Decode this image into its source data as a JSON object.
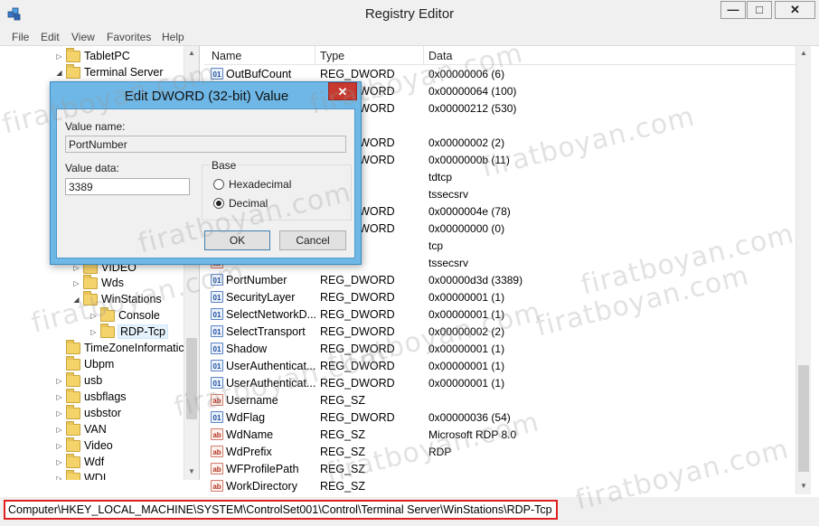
{
  "window": {
    "title": "Registry Editor",
    "minimize_glyph": "—",
    "maximize_glyph": "□",
    "close_glyph": "✕"
  },
  "menu": [
    "File",
    "Edit",
    "View",
    "Favorites",
    "Help"
  ],
  "tree": {
    "items": [
      {
        "label": "TabletPC",
        "arrow": "▷"
      },
      {
        "label": "Terminal Server",
        "arrow": "◢"
      },
      {
        "label": "VIDEO",
        "arrow": "▷"
      },
      {
        "label": "Wds",
        "arrow": "▷"
      },
      {
        "label": "WinStations",
        "arrow": "◢"
      },
      {
        "label": "Console",
        "arrow": "▷"
      },
      {
        "label": "RDP-Tcp",
        "arrow": "▷"
      },
      {
        "label": "TimeZoneInformatic",
        "arrow": ""
      },
      {
        "label": "Ubpm",
        "arrow": ""
      },
      {
        "label": "usb",
        "arrow": "▷"
      },
      {
        "label": "usbflags",
        "arrow": "▷"
      },
      {
        "label": "usbstor",
        "arrow": "▷"
      },
      {
        "label": "VAN",
        "arrow": "▷"
      },
      {
        "label": "Video",
        "arrow": "▷"
      },
      {
        "label": "Wdf",
        "arrow": "▷"
      },
      {
        "label": "WDI",
        "arrow": "▷"
      }
    ]
  },
  "list": {
    "columns": [
      "Name",
      "Type",
      "Data"
    ],
    "rows": [
      {
        "name": "OutBufCount",
        "type": "REG_DWORD",
        "data": "0x00000006 (6)",
        "kind": "bin"
      },
      {
        "name": "",
        "type": "REG_DWORD",
        "data": "0x00000064 (100)",
        "kind": "bin"
      },
      {
        "name": "",
        "type": "REG_DWORD",
        "data": "0x00000212 (530)",
        "kind": "bin"
      },
      {
        "name": "",
        "type": "",
        "data": "",
        "kind": "bin"
      },
      {
        "name": "",
        "type": "REG_DWORD",
        "data": "0x00000002 (2)",
        "kind": "bin"
      },
      {
        "name": "",
        "type": "REG_DWORD",
        "data": "0x0000000b (11)",
        "kind": "bin"
      },
      {
        "name": "",
        "type": "",
        "data": "tdtcp",
        "kind": "str"
      },
      {
        "name": "",
        "type": "",
        "data": "tssecsrv",
        "kind": "str"
      },
      {
        "name": "",
        "type": "REG_DWORD",
        "data": "0x0000004e (78)",
        "kind": "bin"
      },
      {
        "name": "",
        "type": "REG_DWORD",
        "data": "0x00000000 (0)",
        "kind": "bin"
      },
      {
        "name": "",
        "type": "",
        "data": "tcp",
        "kind": "str"
      },
      {
        "name": "",
        "type": "",
        "data": "tssecsrv",
        "kind": "str"
      },
      {
        "name": "PortNumber",
        "type": "REG_DWORD",
        "data": "0x00000d3d (3389)",
        "kind": "bin"
      },
      {
        "name": "SecurityLayer",
        "type": "REG_DWORD",
        "data": "0x00000001 (1)",
        "kind": "bin"
      },
      {
        "name": "SelectNetworkD...",
        "type": "REG_DWORD",
        "data": "0x00000001 (1)",
        "kind": "bin"
      },
      {
        "name": "SelectTransport",
        "type": "REG_DWORD",
        "data": "0x00000002 (2)",
        "kind": "bin"
      },
      {
        "name": "Shadow",
        "type": "REG_DWORD",
        "data": "0x00000001 (1)",
        "kind": "bin"
      },
      {
        "name": "UserAuthenticat...",
        "type": "REG_DWORD",
        "data": "0x00000001 (1)",
        "kind": "bin"
      },
      {
        "name": "UserAuthenticat...",
        "type": "REG_DWORD",
        "data": "0x00000001 (1)",
        "kind": "bin"
      },
      {
        "name": "Username",
        "type": "REG_SZ",
        "data": "",
        "kind": "str"
      },
      {
        "name": "WdFlag",
        "type": "REG_DWORD",
        "data": "0x00000036 (54)",
        "kind": "bin"
      },
      {
        "name": "WdName",
        "type": "REG_SZ",
        "data": "Microsoft RDP 8.0",
        "kind": "str"
      },
      {
        "name": "WdPrefix",
        "type": "REG_SZ",
        "data": "RDP",
        "kind": "str"
      },
      {
        "name": "WFProfilePath",
        "type": "REG_SZ",
        "data": "",
        "kind": "str"
      },
      {
        "name": "WorkDirectory",
        "type": "REG_SZ",
        "data": "",
        "kind": "str"
      }
    ]
  },
  "status": {
    "path": "Computer\\HKEY_LOCAL_MACHINE\\SYSTEM\\ControlSet001\\Control\\Terminal Server\\WinStations\\RDP-Tcp"
  },
  "dialog": {
    "title": "Edit DWORD (32-bit) Value",
    "close_glyph": "✕",
    "value_name_label": "Value name:",
    "value_name": "PortNumber",
    "value_data_label": "Value data:",
    "value_data": "3389",
    "base_label": "Base",
    "hex_label": "Hexadecimal",
    "dec_label": "Decimal",
    "selected_base": "Decimal",
    "ok_label": "OK",
    "cancel_label": "Cancel"
  },
  "watermark": "firatboyan.com",
  "colors": {
    "dialog_frame": "#6fb7e6",
    "close_button": "#c7392e",
    "status_highlight": "#e02020"
  }
}
